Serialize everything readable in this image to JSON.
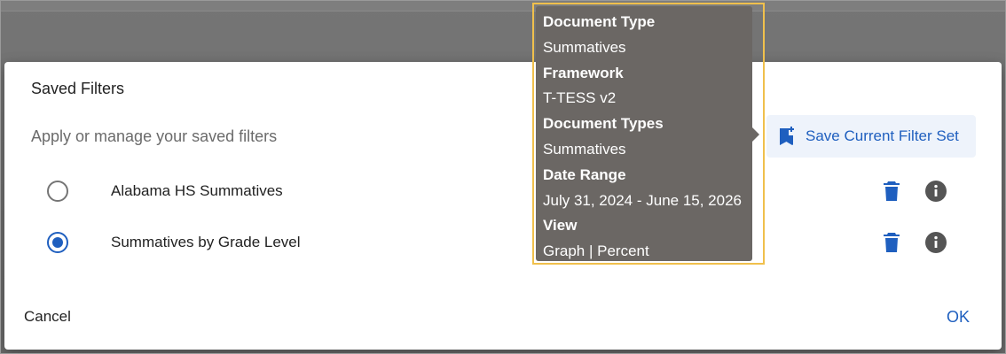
{
  "dialog": {
    "title": "Saved Filters",
    "subtitle": "Apply or manage your saved filters",
    "save_button_label": "Save Current Filter Set",
    "cancel_label": "Cancel",
    "ok_label": "OK"
  },
  "filters": [
    {
      "label": "Alabama HS Summatives",
      "selected": false
    },
    {
      "label": "Summatives by Grade Level",
      "selected": true
    }
  ],
  "tooltip": {
    "document_type_label": "Document Type",
    "document_type_value": "Summatives",
    "framework_label": "Framework",
    "framework_value": "T-TESS v2",
    "document_types_label": "Document Types",
    "document_types_value": "Summatives",
    "date_range_label": "Date Range",
    "date_range_value": "July 31, 2024 - June 15, 2026",
    "view_label": "View",
    "view_value": "Graph | Percent"
  },
  "icons": {
    "save": "bookmark-add-icon",
    "delete": "trash-icon",
    "info": "info-icon"
  },
  "colors": {
    "accent": "#1f5fbf",
    "tooltip_bg": "#6b6764",
    "highlight": "#f0c04c",
    "info_icon": "#555555"
  }
}
